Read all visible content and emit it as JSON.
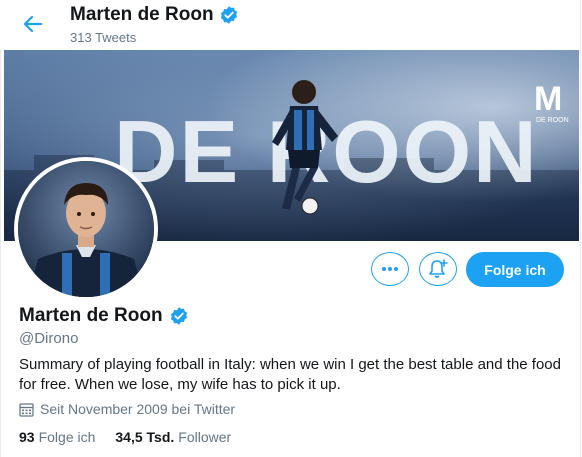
{
  "header": {
    "name": "Marten de Roon",
    "tweet_count": "313 Tweets"
  },
  "banner": {
    "text": "DE ROON",
    "logo_letter": "M",
    "logo_caption": "DE ROON"
  },
  "actions": {
    "follow_label": "Folge ich"
  },
  "profile": {
    "name": "Marten de Roon",
    "handle": "@Dirono",
    "bio": "Summary of playing football in Italy: when we win I get the best table and the food for free. When we lose, my wife has to pick it up.",
    "joined": "Seit November 2009 bei Twitter",
    "following_count": "93",
    "following_label": "Folge ich",
    "followers_count": "34,5 Tsd.",
    "followers_label": "Follower"
  },
  "colors": {
    "accent": "#1da1f2",
    "secondary_text": "#657786"
  },
  "icons": [
    "back-arrow-icon",
    "verified-badge-icon",
    "more-icon",
    "bell-plus-icon",
    "calendar-icon"
  ]
}
